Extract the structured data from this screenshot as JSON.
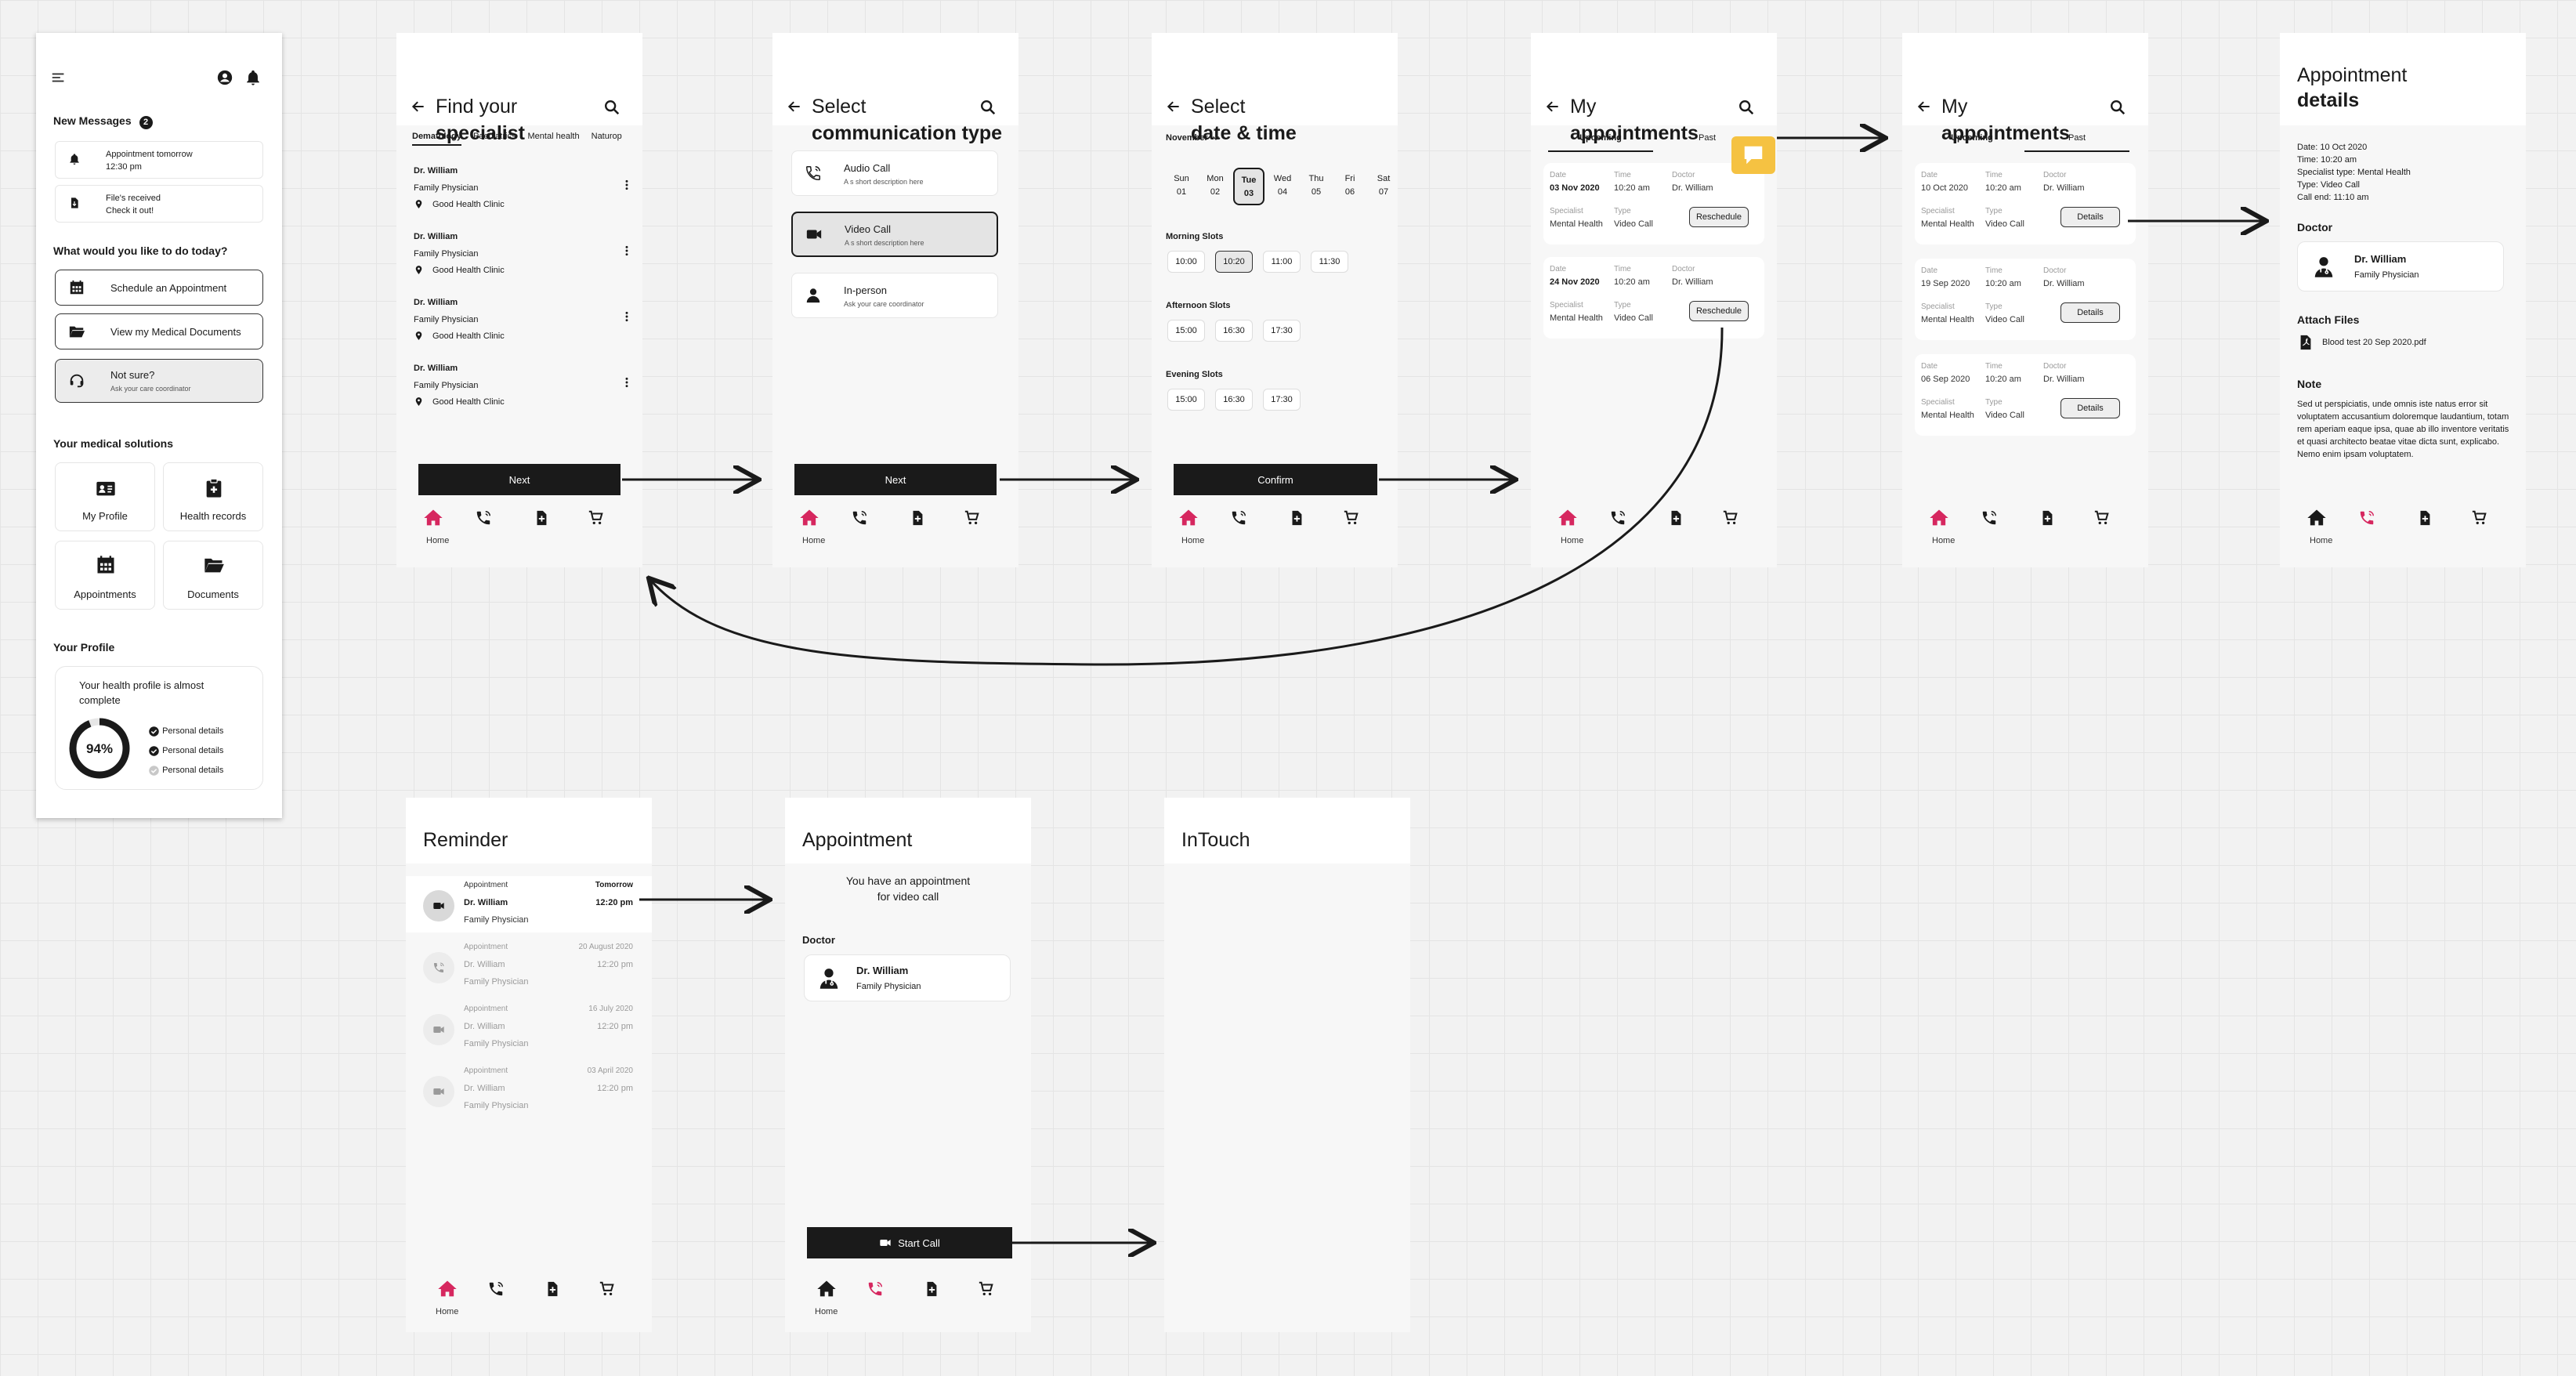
{
  "colors": {
    "accent": "#d6275f",
    "badge": "#f5c242",
    "dark": "#1a1a1a"
  },
  "nav": {
    "home": "Home"
  },
  "dashboard": {
    "new_messages": "New Messages",
    "messages_count": "2",
    "msg1_line1": "Appointment tomorrow",
    "msg1_line2": "12:30 pm",
    "msg2_line1": "File's received",
    "msg2_line2": "Check it out!",
    "question": "What would you like to do today?",
    "action1": "Schedule an Appointment",
    "action2": "View my Medical Documents",
    "action3": "Not sure?",
    "action3_sub": "Ask your care coordinator",
    "solutions_title": "Your medical solutions",
    "sol1": "My Profile",
    "sol2": "Health records",
    "sol3": "Appointments",
    "sol4": "Documents",
    "profile_title": "Your Profile",
    "profile_text": "Your health profile is almost complete",
    "progress_label": "94%",
    "progress_value": 0.94,
    "check1": "Personal details",
    "check2": "Personal details",
    "check3": "Personal details"
  },
  "specialist": {
    "title1": "Find your",
    "title2": "specialist",
    "tabs": [
      "Dematology",
      "Paediatrics",
      "Mental health",
      "Naturop"
    ],
    "doctors": [
      {
        "name": "Dr. William",
        "role": "Family Physician",
        "clinic": "Good Health Clinic"
      },
      {
        "name": "Dr. William",
        "role": "Family Physician",
        "clinic": "Good Health Clinic"
      },
      {
        "name": "Dr. William",
        "role": "Family Physician",
        "clinic": "Good Health Clinic"
      },
      {
        "name": "Dr. William",
        "role": "Family Physician",
        "clinic": "Good Health Clinic"
      }
    ],
    "next": "Next"
  },
  "comm": {
    "title1": "Select",
    "title2": "communication type",
    "opt1": "Audio Call",
    "opt1_sub": "A s short description here",
    "opt2": "Video Call",
    "opt2_sub": "A s short description here",
    "opt3": "In-person",
    "opt3_sub": "Ask your care coordinator",
    "next": "Next"
  },
  "datetime": {
    "title1": "Select",
    "title2": "date & time",
    "month": "November",
    "days": [
      [
        "Sun",
        "01"
      ],
      [
        "Mon",
        "02"
      ],
      [
        "Tue",
        "03"
      ],
      [
        "Wed",
        "04"
      ],
      [
        "Thu",
        "05"
      ],
      [
        "Fri",
        "06"
      ],
      [
        "Sat",
        "07"
      ]
    ],
    "morning": "Morning Slots",
    "morning_slots": [
      "10:00",
      "10:20",
      "11:00",
      "11:30"
    ],
    "afternoon": "Afternoon Slots",
    "afternoon_slots": [
      "15:00",
      "16:30",
      "17:30"
    ],
    "evening": "Evening Slots",
    "evening_slots": [
      "15:00",
      "16:30",
      "17:30"
    ],
    "confirm": "Confirm"
  },
  "myappt": {
    "title1": "My",
    "title2": "appointments",
    "tab_upcoming": "Upcoming",
    "tab_past": "Past",
    "l_date": "Date",
    "l_time": "Time",
    "l_doctor": "Doctor",
    "l_spec": "Specialist",
    "l_type": "Type",
    "items": [
      {
        "date": "03 Nov 2020",
        "time": "10:20 am",
        "doctor": "Dr. William",
        "spec": "Mental Health",
        "type": "Video Call",
        "btn": "Reschedule"
      },
      {
        "date": "24 Nov 2020",
        "time": "10:20 am",
        "doctor": "Dr. William",
        "spec": "Mental Health",
        "type": "Video Call",
        "btn": "Reschedule"
      }
    ]
  },
  "pastappt": {
    "title1": "My",
    "title2": "appointments",
    "tab_upcoming": "Upcoming",
    "tab_past": "Past",
    "items": [
      {
        "date": "10 Oct 2020",
        "time": "10:20 am",
        "doctor": "Dr. William",
        "spec": "Mental Health",
        "type": "Video Call",
        "btn": "Details"
      },
      {
        "date": "19 Sep 2020",
        "time": "10:20 am",
        "doctor": "Dr. William",
        "spec": "Mental Health",
        "type": "Video Call",
        "btn": "Details"
      },
      {
        "date": "06 Sep 2020",
        "time": "10:20 am",
        "doctor": "Dr. William",
        "spec": "Mental Health",
        "type": "Video Call",
        "btn": "Details"
      }
    ]
  },
  "details": {
    "title1": "Appointment",
    "title2": "details",
    "info": [
      "Date: 10 Oct 2020",
      "Time: 10:20 am",
      "Specialist type: Mental Health",
      "Type: Video Call",
      "Call end: 11:10 am"
    ],
    "doctor_label": "Doctor",
    "doctor_name": "Dr. William",
    "doctor_role": "Family Physician",
    "files_label": "Attach Files",
    "file": "Blood test 20 Sep 2020.pdf",
    "note_label": "Note",
    "note": "Sed ut perspiciatis, unde omnis iste natus error sit voluptatem accusantium doloremque laudantium, totam rem aperiam eaque ipsa, quae ab illo inventore veritatis et quasi architecto beatae vitae dicta sunt, explicabo. Nemo enim ipsam voluptatem."
  },
  "reminder": {
    "title": "Reminder",
    "items": [
      {
        "label": "Appointment",
        "when": "Tomorrow",
        "name": "Dr. William",
        "time": "12:20 pm",
        "role": "Family Physician"
      },
      {
        "label": "Appointment",
        "when": "20 August 2020",
        "name": "Dr. William",
        "time": "12:20 pm",
        "role": "Family Physician"
      },
      {
        "label": "Appointment",
        "when": "16 July 2020",
        "name": "Dr. William",
        "time": "12:20 pm",
        "role": "Family Physician"
      },
      {
        "label": "Appointment",
        "when": "03 April 2020",
        "name": "Dr. William",
        "time": "12:20 pm",
        "role": "Family Physician"
      }
    ]
  },
  "appointment": {
    "title": "Appointment",
    "text1": "You have an appointment",
    "text2": "for video call",
    "doctor_label": "Doctor",
    "doctor_name": "Dr. William",
    "doctor_role": "Family Physician",
    "start": "Start Call"
  },
  "intouch": {
    "title": "InTouch"
  }
}
